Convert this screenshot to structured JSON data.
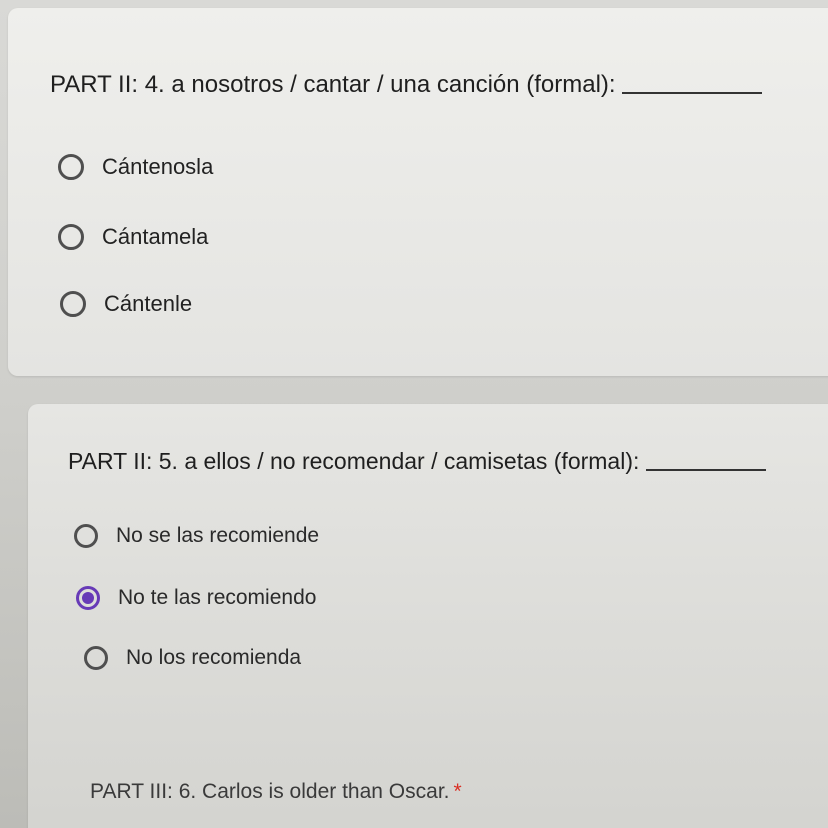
{
  "questions": [
    {
      "id": "q4",
      "prompt": "PART II: 4. a nosotros / cantar / una canción (formal):",
      "options": [
        {
          "label": "Cántenosla",
          "selected": false
        },
        {
          "label": "Cántamela",
          "selected": false
        },
        {
          "label": "Cántenle",
          "selected": false
        }
      ]
    },
    {
      "id": "q5",
      "prompt": "PART II: 5. a ellos / no recomendar / camisetas (formal):",
      "options": [
        {
          "label": "No se las recomiende",
          "selected": false
        },
        {
          "label": "No te las recomiendo",
          "selected": true
        },
        {
          "label": "No los recomienda",
          "selected": false
        }
      ]
    },
    {
      "id": "q6",
      "prompt": "PART III: 6. Carlos is older than Oscar.",
      "required_marker": "*"
    }
  ],
  "colors": {
    "selected_radio": "#673ab7",
    "required": "#d93025"
  },
  "icons": {
    "radio_unselected": "radio-unselected-icon",
    "radio_selected": "radio-selected-icon"
  }
}
